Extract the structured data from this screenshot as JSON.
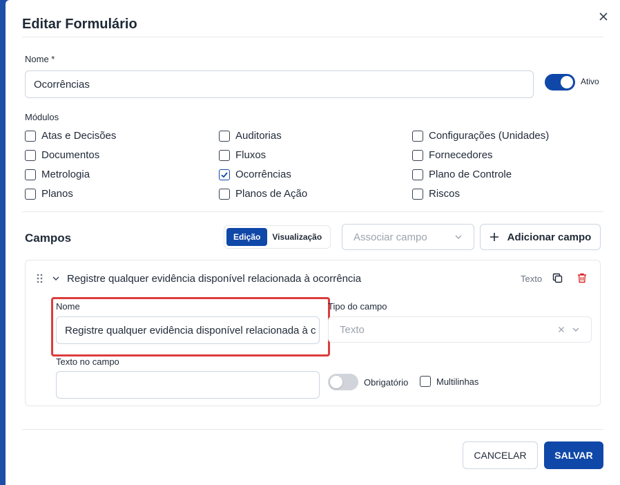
{
  "dialog": {
    "title": "Editar Formulário",
    "close_icon": "close-icon"
  },
  "name_field": {
    "label": "Nome *",
    "value": "Ocorrências",
    "active_label": "Ativo",
    "active": true
  },
  "modules": {
    "label": "Módulos",
    "items": [
      {
        "label": "Atas e Decisões",
        "checked": false
      },
      {
        "label": "Auditorias",
        "checked": false
      },
      {
        "label": "Configurações (Unidades)",
        "checked": false
      },
      {
        "label": "Documentos",
        "checked": false
      },
      {
        "label": "Fluxos",
        "checked": false
      },
      {
        "label": "Fornecedores",
        "checked": false
      },
      {
        "label": "Metrologia",
        "checked": false
      },
      {
        "label": "Ocorrências",
        "checked": true
      },
      {
        "label": "Plano de Controle",
        "checked": false
      },
      {
        "label": "Planos",
        "checked": false
      },
      {
        "label": "Planos de Ação",
        "checked": false
      },
      {
        "label": "Riscos",
        "checked": false
      }
    ]
  },
  "fields_section": {
    "title": "Campos",
    "tabs": [
      "Edição",
      "Visualização"
    ],
    "active_tab": "Edição",
    "associate_placeholder": "Associar campo",
    "add_button": "Adicionar campo"
  },
  "field_item": {
    "title": "Registre qualquer evidência disponível relacionada à ocorrência",
    "type_badge": "Texto",
    "name_label": "Nome",
    "name_value": "Registre qualquer evidência disponível relacionada à c",
    "type_label": "Tipo do campo",
    "type_value": "Texto",
    "placeholder_label": "Texto no campo",
    "placeholder_value": "",
    "required_label": "Obrigatório",
    "required": false,
    "multiline_label": "Multilinhas",
    "multiline": false
  },
  "footer": {
    "cancel": "CANCELAR",
    "save": "SALVAR"
  },
  "colors": {
    "primary": "#0f48a8",
    "danger": "#dc3c3c",
    "backdrop": "#1d4fa8"
  }
}
